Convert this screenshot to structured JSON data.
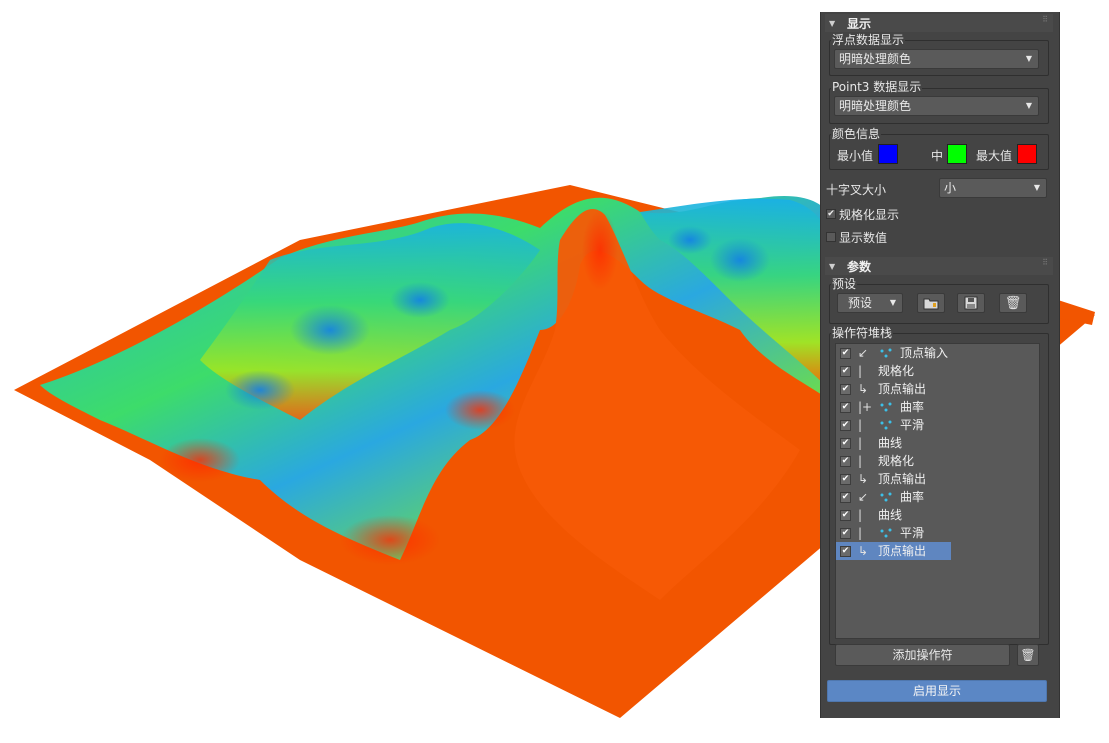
{
  "display": {
    "title": "显示",
    "float_group": {
      "label": "浮点数据显示",
      "value": "明暗处理颜色"
    },
    "point3_group": {
      "label": "Point3 数据显示",
      "value": "明暗处理颜色"
    },
    "color_group": {
      "label": "颜色信息",
      "min_label": "最小值",
      "min_color": "#0000ff",
      "mid_label": "中",
      "mid_color": "#00ff00",
      "max_label": "最大值",
      "max_color": "#ff0000"
    },
    "cross_size": {
      "label": "十字叉大小",
      "value": "小"
    },
    "normalize_display": {
      "label": "规格化显示",
      "checked": true
    },
    "show_values": {
      "label": "显示数值",
      "checked": false
    }
  },
  "params": {
    "title": "参数",
    "preset_group": {
      "label": "预设",
      "preset_value": "预设"
    },
    "stack_label": "操作符堆栈",
    "stack": [
      {
        "text": "顶点输入",
        "glyph": "↙",
        "icon": true,
        "checked": true
      },
      {
        "text": "规格化",
        "glyph": "|",
        "icon": false,
        "checked": true
      },
      {
        "text": "顶点输出",
        "glyph": "↳",
        "icon": false,
        "checked": true
      },
      {
        "text": "曲率",
        "glyph": "|+",
        "icon": true,
        "checked": true
      },
      {
        "text": "平滑",
        "glyph": "|",
        "icon": true,
        "checked": true
      },
      {
        "text": "曲线",
        "glyph": "|",
        "icon": false,
        "checked": true
      },
      {
        "text": "规格化",
        "glyph": "|",
        "icon": false,
        "checked": true
      },
      {
        "text": "顶点输出",
        "glyph": "↳",
        "icon": false,
        "checked": true
      },
      {
        "text": "曲率",
        "glyph": "↙",
        "icon": true,
        "checked": true
      },
      {
        "text": "曲线",
        "glyph": "|",
        "icon": false,
        "checked": true
      },
      {
        "text": "平滑",
        "glyph": "|",
        "icon": true,
        "checked": true
      },
      {
        "text": "顶点输出",
        "glyph": "↳",
        "icon": false,
        "checked": true,
        "selected": true
      }
    ],
    "add_operator": "添加操作符",
    "enable_display": "启用显示"
  },
  "colors": {
    "accent": "#5b87c5",
    "panel_bg": "#444444",
    "terrain_base": "#f25500"
  },
  "icons": [
    "rollout-arrow-icon",
    "grip-icon",
    "dropdown-caret-icon",
    "open-folder-icon",
    "save-icon",
    "trash-icon",
    "vertex-node-icon",
    "checkmark-icon"
  ]
}
